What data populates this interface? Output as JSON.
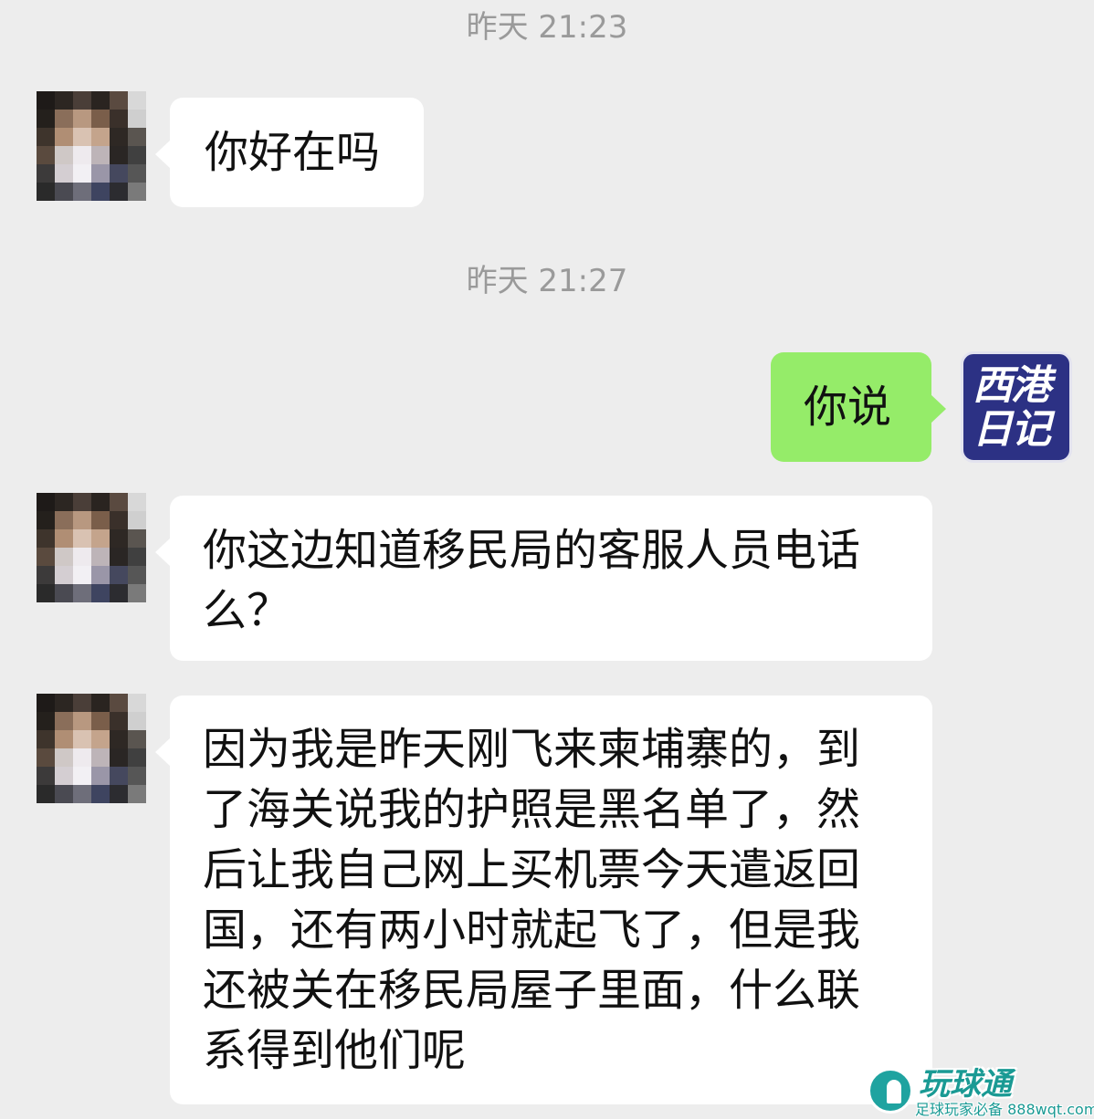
{
  "timestamps": [
    "昨天 21:23",
    "昨天 21:27"
  ],
  "messages": {
    "m1": "你好在吗",
    "m2": "你说",
    "m3": "你这边知道移民局的客服人员电话么？",
    "m4": "因为我是昨天刚飞来柬埔寨的，到了海关说我的护照是黑名单了，然后让我自己网上买机票今天遣返回国，还有两小时就起飞了，但是我还被关在移民局屋子里面，什么联系得到他们呢"
  },
  "self_avatar": {
    "line1": "西港",
    "line2": "日记",
    "background": "#2c3184"
  },
  "watermark": {
    "title": "玩球通",
    "subtitle": "足球玩家必备 888wqt.com",
    "color": "#1a9a94"
  },
  "colors": {
    "background": "#ededed",
    "incoming_bubble": "#ffffff",
    "outgoing_bubble": "#95ec69",
    "timestamp": "#9a9a9a"
  },
  "icons": {
    "contact_avatar": "pixelated-avatar",
    "self_avatar": "xigang-riji-logo",
    "watermark_logo": "soccer-player-icon"
  }
}
